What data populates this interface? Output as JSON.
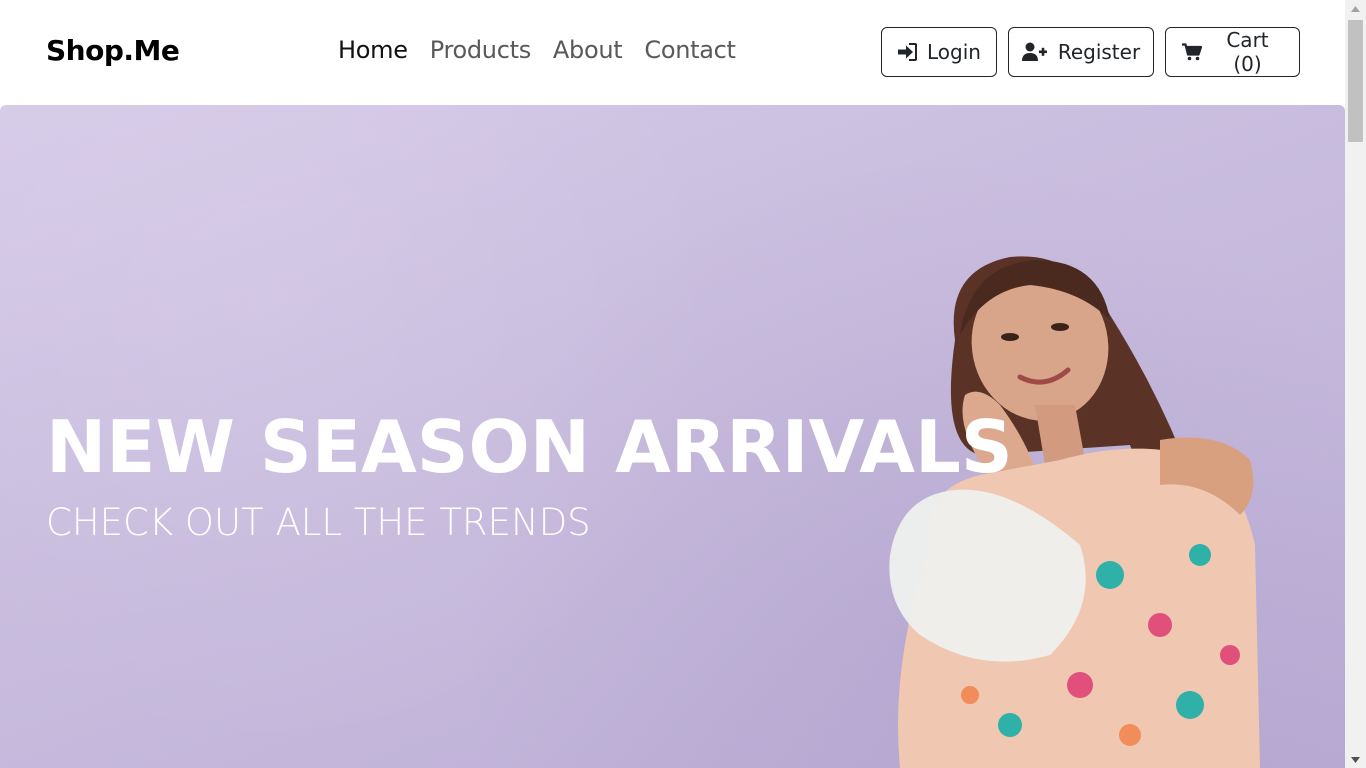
{
  "navbar": {
    "brand": "Shop.Me",
    "links": [
      {
        "label": "Home",
        "active": true
      },
      {
        "label": "Products",
        "active": false
      },
      {
        "label": "About",
        "active": false
      },
      {
        "label": "Contact",
        "active": false
      }
    ],
    "buttons": {
      "login": {
        "label": "Login",
        "icon": "sign-in-icon"
      },
      "register": {
        "label": "Register",
        "icon": "user-plus-icon"
      },
      "cart": {
        "label": "Cart (0)",
        "icon": "shopping-cart-icon"
      }
    }
  },
  "hero": {
    "title": "NEW SEASON ARRIVALS",
    "subtitle": "CHECK OUT ALL THE TRENDS",
    "background_color": "#cbbfe0"
  }
}
